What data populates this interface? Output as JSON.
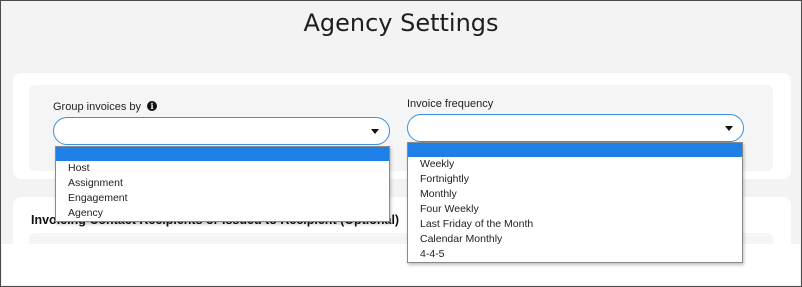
{
  "page": {
    "title": "Agency Settings"
  },
  "group_invoices": {
    "label": "Group invoices by",
    "info_glyph": "i",
    "value": "",
    "options": [
      "",
      "Host",
      "Assignment",
      "Engagement",
      "Agency"
    ]
  },
  "invoice_frequency": {
    "label": "Invoice frequency",
    "value": "",
    "options": [
      "",
      "Weekly",
      "Fortnightly",
      "Monthly",
      "Four Weekly",
      "Last Friday of the Month",
      "Calendar Monthly",
      "4-4-5"
    ]
  },
  "contacts_section": {
    "heading": "Invoicing Contact Recipients or Issued to Recipient (Optional)"
  },
  "colors": {
    "accent": "#1e7fe6",
    "border_focus": "#3b8fe0"
  },
  "icons": {
    "info": "info-icon",
    "caret": "chevron-down-icon"
  }
}
